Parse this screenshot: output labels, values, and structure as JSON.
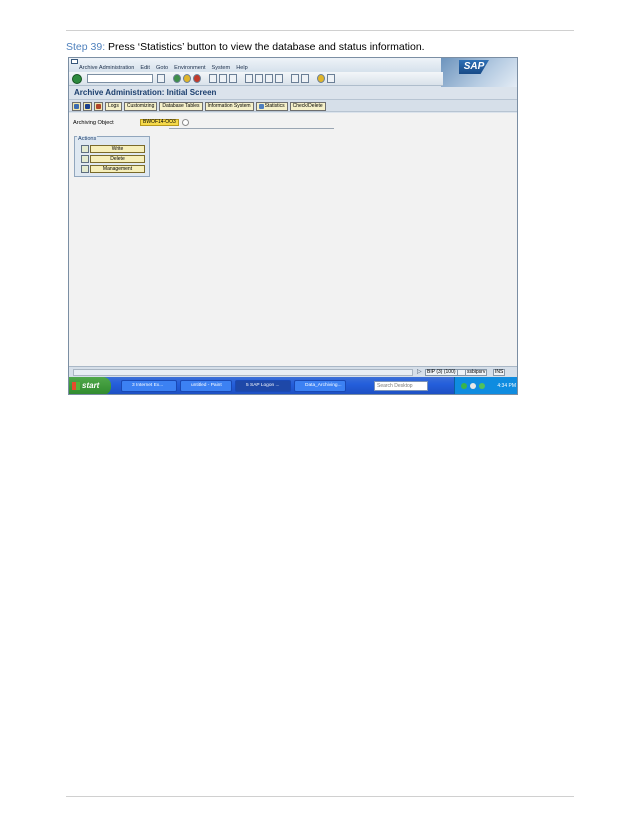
{
  "instruction": {
    "step_label": "Step 39:",
    "text": "Press ‘Statistics’ button to view the database and status information."
  },
  "sap": {
    "menu": [
      "Archive Administration",
      "Edit",
      "Goto",
      "Environment",
      "System",
      "Help"
    ],
    "logo": "SAP",
    "screen_title": "Archive Administration: Initial Screen",
    "app_toolbar": [
      "Logs",
      "Customizing",
      "Database Tables",
      "Information System",
      "Statistics",
      "Check/Delete"
    ],
    "field": {
      "label": "Archiving Object",
      "value": "BWOF14-OO3"
    },
    "actions": {
      "title": "Actions",
      "items": [
        "Write",
        "Delete",
        "Management"
      ]
    },
    "status": {
      "system": "BIP (3) (100)",
      "server": "ssbipsrv",
      "mode": "INS"
    }
  },
  "taskbar": {
    "start": "start",
    "tasks": [
      "3 Internet Ex...",
      "untitled - Paint",
      "5 SAP Logon ...",
      "Data_Archiving..."
    ],
    "search_placeholder": "Search Desktop",
    "clock": "4:34 PM"
  }
}
